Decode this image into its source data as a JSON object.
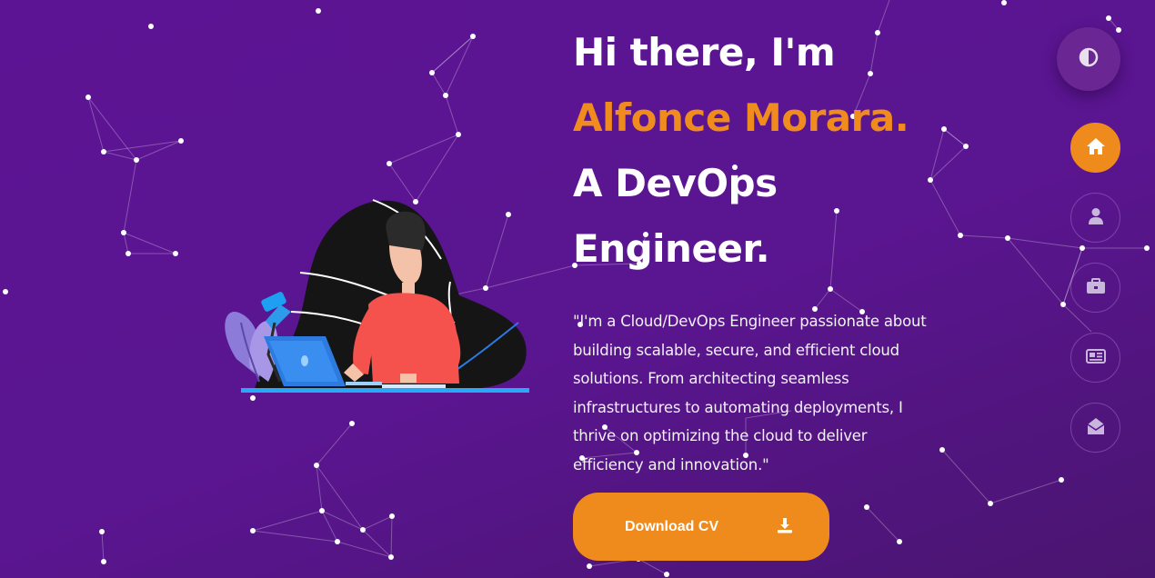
{
  "hero": {
    "greeting": "Hi there, I'm",
    "name": "Alfonce Morara.",
    "role": "A DevOps Engineer.",
    "intro": "\"I'm a Cloud/DevOps Engineer passionate about building scalable, secure, and efficient cloud solutions. From architecting seamless infrastructures to automating deployments, I thrive on optimizing the cloud to deliver efficiency and innovation.\""
  },
  "download_button": {
    "label": "Download CV",
    "icon": "download-icon"
  },
  "theme_toggle": {
    "icon": "contrast-icon"
  },
  "nav": {
    "items": [
      {
        "id": "home",
        "icon": "home-icon",
        "active": true
      },
      {
        "id": "about",
        "icon": "user-icon",
        "active": false
      },
      {
        "id": "portfolio",
        "icon": "briefcase-icon",
        "active": false
      },
      {
        "id": "blog",
        "icon": "newspaper-icon",
        "active": false
      },
      {
        "id": "contact",
        "icon": "envelope-open-icon",
        "active": false
      }
    ]
  },
  "colors": {
    "background": "#5c1494",
    "accent": "#ef8a1c",
    "text": "#ffffff"
  }
}
